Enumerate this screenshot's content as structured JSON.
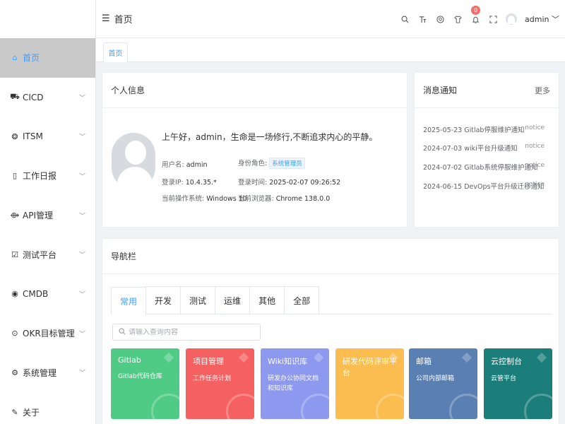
{
  "header": {
    "breadcrumb": "首页",
    "user": "admin",
    "notification_count": "0"
  },
  "sidebar": {
    "items": [
      {
        "label": "首页",
        "icon": "home-icon",
        "active": true
      },
      {
        "label": "CICD",
        "icon": "truck-icon"
      },
      {
        "label": "ITSM",
        "icon": "settings-cube-icon"
      },
      {
        "label": "工作日报",
        "icon": "document-icon"
      },
      {
        "label": "API管理",
        "icon": "api-icon"
      },
      {
        "label": "测试平台",
        "icon": "checkbox-icon"
      },
      {
        "label": "CMDB",
        "icon": "chrome-icon"
      },
      {
        "label": "OKR目标管理",
        "icon": "target-icon"
      },
      {
        "label": "系统管理",
        "icon": "gear-icon"
      },
      {
        "label": "关于",
        "icon": "edit-icon"
      }
    ]
  },
  "tabs_bar": {
    "active_tab": "首页"
  },
  "profile": {
    "title": "个人信息",
    "greeting": "上午好，admin，生命是一场修行,不断追求内心的平静。",
    "username_label": "用户名:",
    "username": "admin",
    "role_label": "身份角色:",
    "role": "系统管理员",
    "ip_label": "登录IP:",
    "ip": "10.4.35.*",
    "login_time_label": "登录时间:",
    "login_time": "2025-02-07 09:26:52",
    "os_label": "当前操作系统:",
    "os": "Windows 10",
    "browser_label": "当前浏览器:",
    "browser": "Chrome 138.0.0"
  },
  "notices": {
    "title": "消息通知",
    "more": "更多",
    "items": [
      {
        "text": "2025-05-23 Gitlab停服维护通知",
        "type": "notice"
      },
      {
        "text": "2024-07-03 wiki平台升级通知",
        "type": "notice"
      },
      {
        "text": "2024-07-02 Gitlab系统停服维护通知",
        "type": "notice"
      },
      {
        "text": "2024-06-15 DevOps平台升级迁移通知",
        "type": "notice"
      }
    ]
  },
  "navigation": {
    "title": "导航栏",
    "tabs": [
      "常用",
      "开发",
      "测试",
      "运维",
      "其他",
      "全部"
    ],
    "active_tab": "常用",
    "search_placeholder": "请输入查询内容",
    "tiles": [
      {
        "title": "Gitlab",
        "subtitle": "Gitlab代码仓库",
        "color": "#4fcb86"
      },
      {
        "title": "项目管理",
        "subtitle": "工作任务计划",
        "color": "#f56161"
      },
      {
        "title": "Wiki知识库",
        "subtitle": "研发办公协同文档和知识库",
        "color": "#8d98ef"
      },
      {
        "title": "研发代码评审平台",
        "subtitle": "",
        "color": "#fbbd4f"
      },
      {
        "title": "邮箱",
        "subtitle": "公司内部邮箱",
        "color": "#5a7fb2"
      },
      {
        "title": "云控制台",
        "subtitle": "云管平台",
        "color": "#1b7e7a"
      }
    ]
  }
}
